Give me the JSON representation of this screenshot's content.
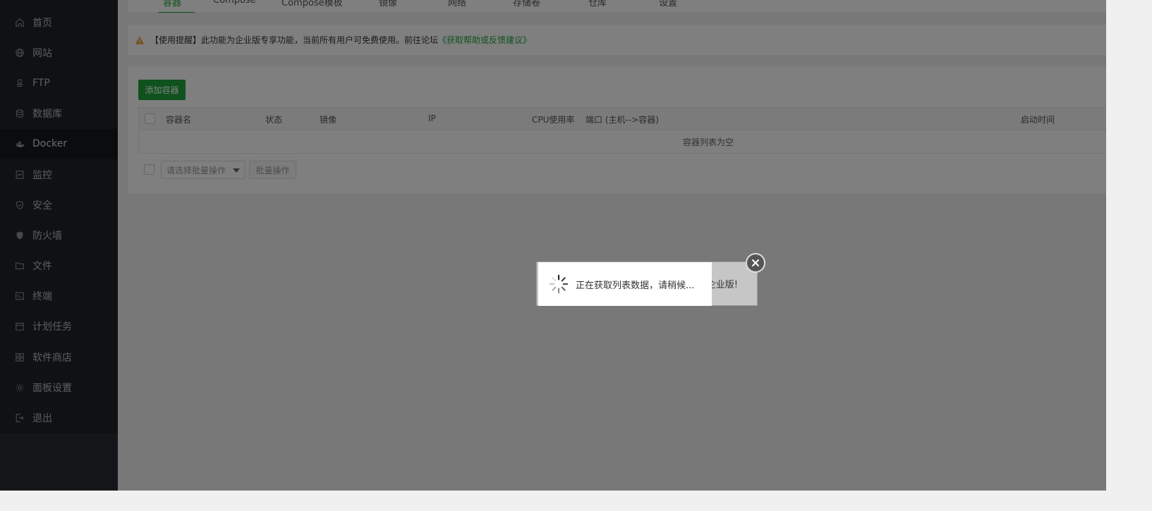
{
  "sidebar": {
    "items": [
      {
        "label": "首页",
        "icon": "home-icon"
      },
      {
        "label": "网站",
        "icon": "globe-icon"
      },
      {
        "label": "FTP",
        "icon": "ftp-icon"
      },
      {
        "label": "数据库",
        "icon": "database-icon"
      },
      {
        "label": "Docker",
        "icon": "docker-icon"
      },
      {
        "label": "监控",
        "icon": "monitor-icon"
      },
      {
        "label": "安全",
        "icon": "shield-icon"
      },
      {
        "label": "防火墙",
        "icon": "firewall-icon"
      },
      {
        "label": "文件",
        "icon": "folder-icon"
      },
      {
        "label": "终端",
        "icon": "terminal-icon"
      },
      {
        "label": "计划任务",
        "icon": "calendar-icon"
      },
      {
        "label": "软件商店",
        "icon": "grid-icon"
      },
      {
        "label": "面板设置",
        "icon": "gear-icon"
      },
      {
        "label": "退出",
        "icon": "logout-icon"
      }
    ],
    "active_index": 4
  },
  "tabs": [
    {
      "label": "容器"
    },
    {
      "label": "Compose"
    },
    {
      "label": "Compose模板"
    },
    {
      "label": "镜像"
    },
    {
      "label": "网络"
    },
    {
      "label": "存储卷"
    },
    {
      "label": "仓库"
    },
    {
      "label": "设置"
    }
  ],
  "notice": {
    "text": "【使用提醒】此功能为企业版专享功能，当前所有用户可免费使用。前往论坛",
    "link": "《获取帮助或反馈建议》"
  },
  "toolbar": {
    "add_label": "添加容器"
  },
  "table": {
    "columns": [
      "容器名",
      "状态",
      "镜像",
      "IP",
      "CPU使用率",
      "端口 (主机-->容器)",
      "启动时间"
    ],
    "empty_text": "容器列表为空"
  },
  "batch": {
    "placeholder": "请选择批量操作",
    "button_label": "批量操作"
  },
  "dialog": {
    "behind_text": "企业版!",
    "loading_text": "正在获取列表数据，请稍候..."
  },
  "colors": {
    "accent": "#20a53a",
    "sidebar_bg": "#1f2226"
  }
}
